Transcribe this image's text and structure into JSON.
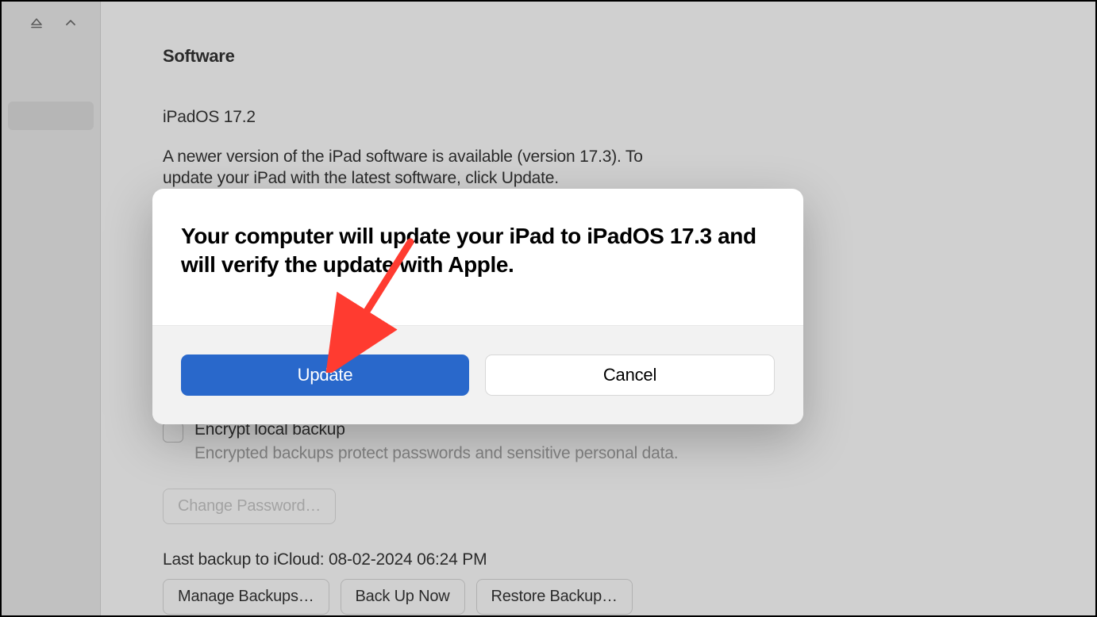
{
  "sidebar": {
    "icons": {
      "eject": "eject",
      "chevron": "chevron-up"
    }
  },
  "software": {
    "section_title": "Software",
    "version_label": "iPadOS 17.2",
    "version_description": "A newer version of the iPad software is available (version 17.3). To update your iPad with the latest software, click Update."
  },
  "backup": {
    "encrypt_label": "Encrypt local backup",
    "encrypt_description": "Encrypted backups protect passwords and sensitive personal data.",
    "change_password_label": "Change Password…",
    "last_backup_text": "Last backup to iCloud: 08-02-2024 06:24 PM",
    "manage_label": "Manage Backups…",
    "backup_now_label": "Back Up Now",
    "restore_label": "Restore Backup…"
  },
  "modal": {
    "title": "Your computer will update your iPad to iPadOS 17.3 and will verify the update with Apple.",
    "update_label": "Update",
    "cancel_label": "Cancel"
  },
  "colors": {
    "primary_blue": "#2968cb",
    "arrow_red": "#ff3b30"
  }
}
